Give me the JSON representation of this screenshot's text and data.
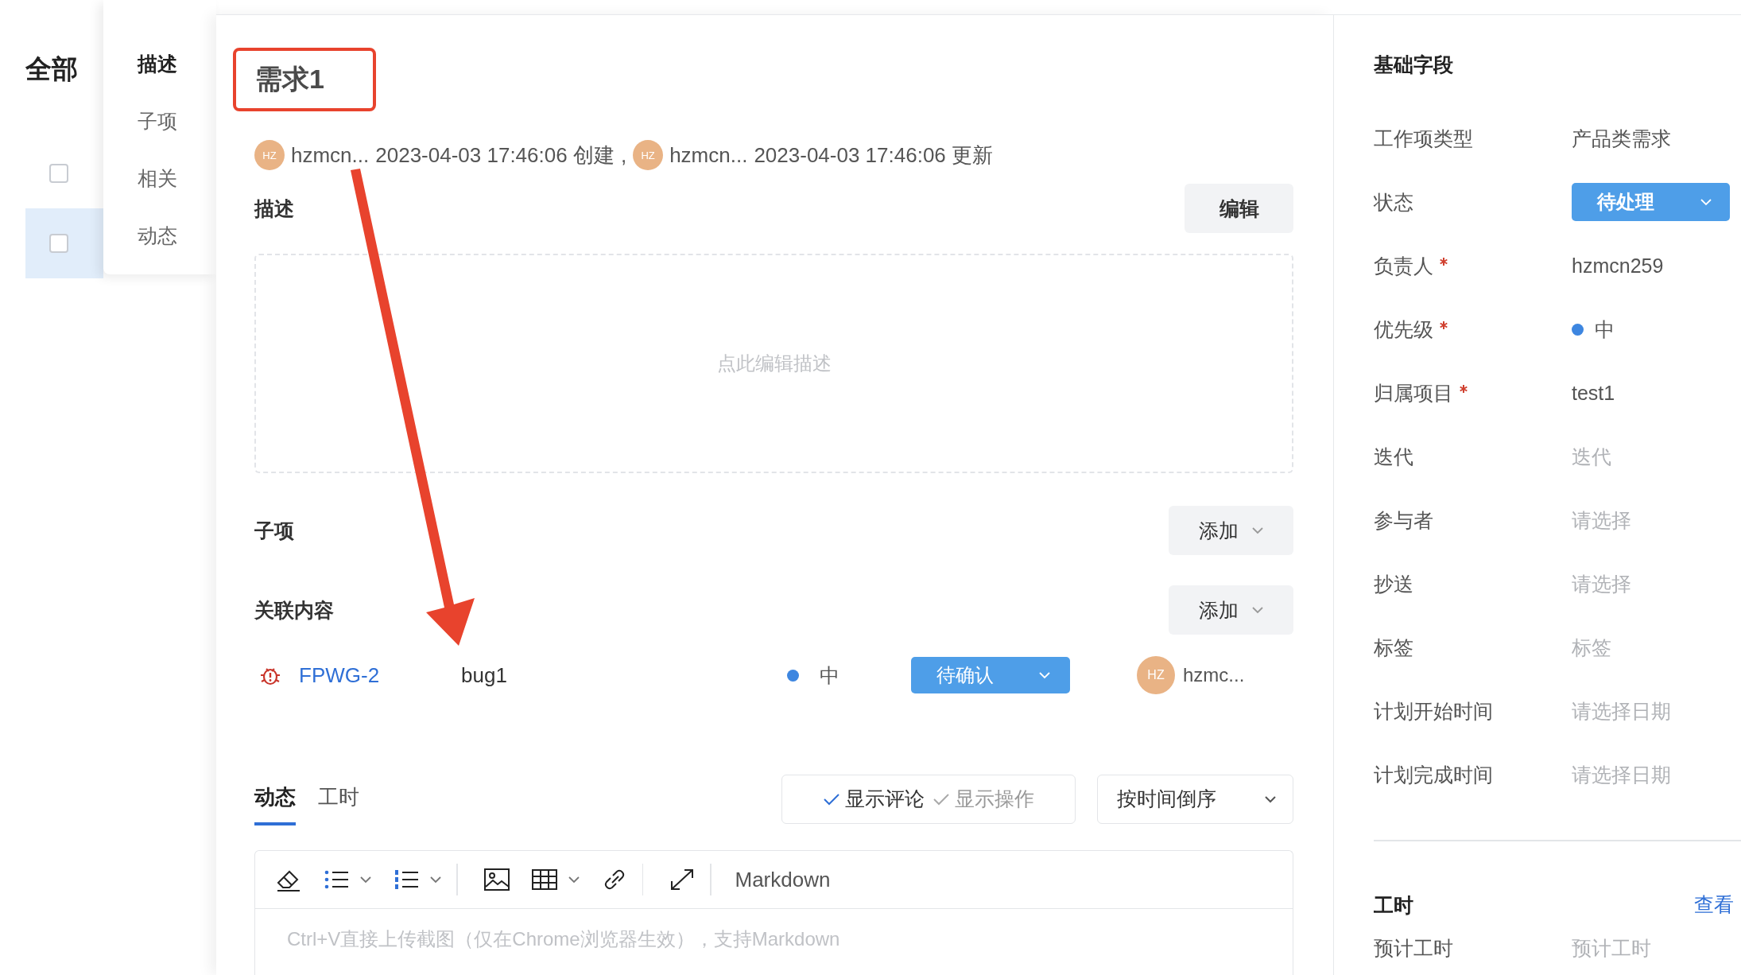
{
  "background_list": {
    "title": "全部",
    "rows": [
      {
        "checked": false,
        "selected": false
      },
      {
        "checked": false,
        "selected": true
      }
    ]
  },
  "anchor_nav": [
    {
      "label": "描述",
      "selected": true
    },
    {
      "label": "子项",
      "selected": false
    },
    {
      "label": "相关",
      "selected": false
    },
    {
      "label": "动态",
      "selected": false
    }
  ],
  "item": {
    "title": "需求1",
    "meta": [
      {
        "avatar": "HZ",
        "name": "hzmcn...",
        "text": "2023-04-03 17:46:06 创建"
      },
      {
        "avatar": "HZ",
        "name": "hzmcn...",
        "text": "2023-04-03 17:46:06 更新"
      }
    ],
    "meta_separator": ","
  },
  "description": {
    "title": "描述",
    "edit_button": "编辑",
    "placeholder": "点此编辑描述"
  },
  "children": {
    "title": "子项",
    "add_button": "添加"
  },
  "related": {
    "title": "关联内容",
    "add_button": "添加",
    "items": [
      {
        "kind": "bug",
        "id": "FPWG-2",
        "title": "bug1",
        "priority": {
          "label": "中",
          "color": "#3d86e0"
        },
        "status": "待确认",
        "assignee": {
          "avatar": "HZ",
          "name": "hzmc..."
        }
      }
    ]
  },
  "activity": {
    "tabs": [
      {
        "label": "动态",
        "selected": true
      },
      {
        "label": "工时",
        "selected": false
      }
    ],
    "filters": [
      {
        "label": "显示评论",
        "checked": true
      },
      {
        "label": "显示操作",
        "checked": false
      }
    ],
    "sort": "按时间倒序",
    "editor": {
      "mode": "Markdown",
      "placeholder": "Ctrl+V直接上传截图（仅在Chrome浏览器生效），支持Markdown"
    }
  },
  "fields_panel": {
    "title": "基础字段",
    "fields": [
      {
        "label": "工作项类型",
        "required": false,
        "kind": "text",
        "value": "产品类需求"
      },
      {
        "label": "状态",
        "required": false,
        "kind": "status",
        "value": "待处理"
      },
      {
        "label": "负责人",
        "required": true,
        "kind": "text",
        "value": "hzmcn259"
      },
      {
        "label": "优先级",
        "required": true,
        "kind": "priority",
        "value": "中",
        "color": "#3d86e0"
      },
      {
        "label": "归属项目",
        "required": true,
        "kind": "text",
        "value": "test1"
      },
      {
        "label": "迭代",
        "required": false,
        "kind": "empty",
        "placeholder": "迭代"
      },
      {
        "label": "参与者",
        "required": false,
        "kind": "empty",
        "placeholder": "请选择"
      },
      {
        "label": "抄送",
        "required": false,
        "kind": "empty",
        "placeholder": "请选择"
      },
      {
        "label": "标签",
        "required": false,
        "kind": "empty",
        "placeholder": "标签"
      },
      {
        "label": "计划开始时间",
        "required": false,
        "kind": "empty",
        "placeholder": "请选择日期"
      },
      {
        "label": "计划完成时间",
        "required": false,
        "kind": "empty",
        "placeholder": "请选择日期"
      }
    ],
    "worktime": {
      "title": "工时",
      "link": "查看",
      "fields": [
        {
          "label": "预计工时",
          "placeholder": "预计工时"
        }
      ]
    }
  }
}
